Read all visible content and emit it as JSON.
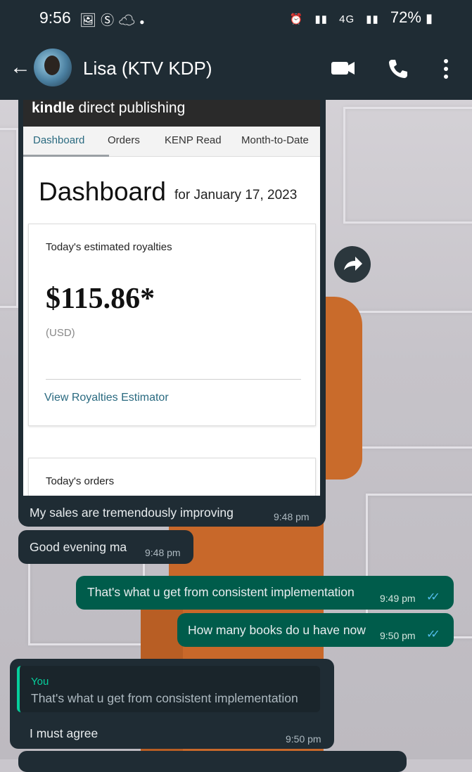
{
  "status_bar": {
    "time": "9:56",
    "left_icons": [
      "gallery-icon",
      "s-icon",
      "cloud-icon",
      "dot-icon"
    ],
    "network": "4G",
    "battery": "72%"
  },
  "header": {
    "contact_name": "Lisa (KTV KDP)",
    "actions": [
      "video-call-icon",
      "voice-call-icon",
      "more-icon"
    ]
  },
  "screenshot": {
    "logo_bold": "kindle",
    "logo_rest": " direct publishing",
    "tabs": [
      "Dashboard",
      "Orders",
      "KENP Read",
      "Month-to-Date"
    ],
    "active_tab": "Dashboard",
    "page_title": "Dashboard",
    "date_label": "for January 17, 2023",
    "royalties_label": "Today's estimated royalties",
    "royalties_value": "$115.86*",
    "currency": "(USD)",
    "estimator_link": "View Royalties Estimator",
    "orders_label": "Today's orders"
  },
  "messages": [
    {
      "direction": "in",
      "text": "My sales are tremendously improving",
      "time": "9:48 pm"
    },
    {
      "direction": "in",
      "text": "Good evening ma",
      "time": "9:48 pm"
    },
    {
      "direction": "out",
      "text": "That's what u get from consistent implementation",
      "time": "9:49 pm",
      "read": true
    },
    {
      "direction": "out",
      "text": "How many books do u have now",
      "time": "9:50 pm",
      "read": true
    },
    {
      "direction": "in",
      "reply_to": {
        "author": "You",
        "text": "That's what u get from consistent implementation"
      },
      "text": "I must agree",
      "time": "9:50 pm"
    }
  ],
  "colors": {
    "header_bg": "#1f2c34",
    "incoming_bubble": "#1f2c34",
    "outgoing_bubble": "#005c4b",
    "read_ticks": "#53bdeb",
    "reply_accent": "#06cf9c",
    "kdp_link": "#2a6a80"
  }
}
